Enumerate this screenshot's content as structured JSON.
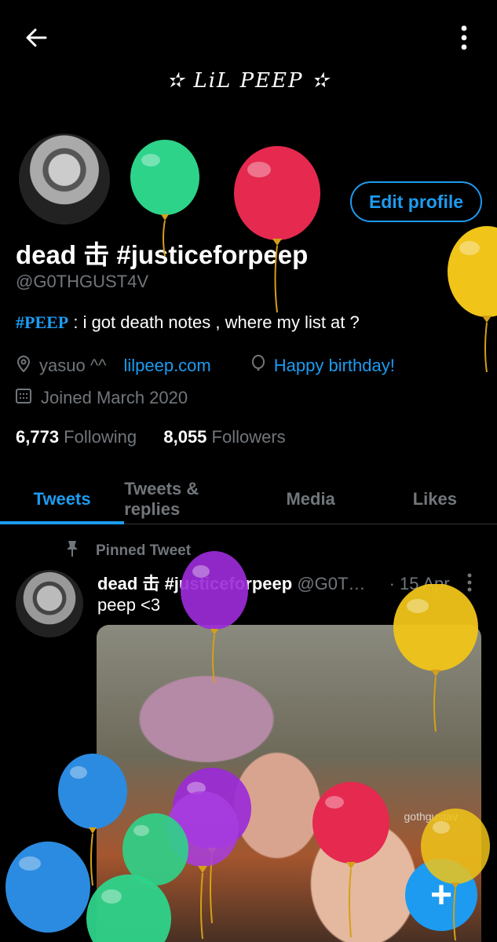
{
  "header": {
    "banner_text": "✫ LiL PEEP ✫"
  },
  "profile": {
    "display_name": "dead 击 #justiceforpeep",
    "handle": "@G0THGUST4V",
    "edit_label": "Edit profile",
    "bio_tag": "#PEEP",
    "bio_text": " : i got death notes , where my list at ?",
    "location": "yasuo ^^",
    "website": "lilpeep.com",
    "birthday": "Happy birthday!",
    "joined": "Joined March 2020",
    "following_count": "6,773",
    "following_label": " Following",
    "followers_count": "8,055",
    "followers_label": " Followers"
  },
  "tabs": [
    {
      "label": "Tweets"
    },
    {
      "label": "Tweets & replies"
    },
    {
      "label": "Media"
    },
    {
      "label": "Likes"
    }
  ],
  "tweet": {
    "pinned_label": "Pinned Tweet",
    "name": "dead 击 #justiceforpeep",
    "handle": "@G0T…",
    "date": "· 15 Apr",
    "text": "peep <3",
    "watermark": "gothgustav"
  },
  "fab_label": "+",
  "colors": {
    "accent": "#1d9bf0",
    "muted": "#71767b",
    "background": "#000000"
  }
}
